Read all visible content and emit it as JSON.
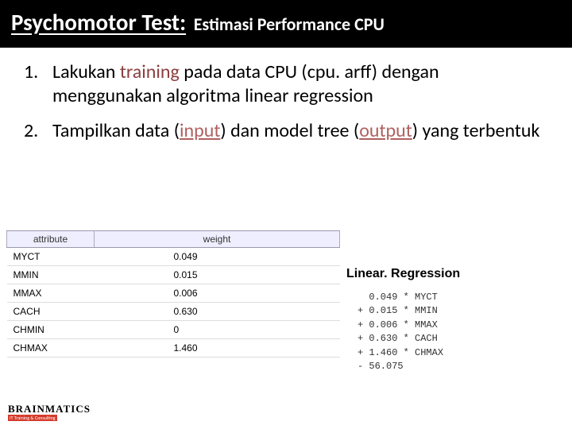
{
  "title": {
    "main": "Psychomotor Test:",
    "sub": "Estimasi Performance CPU"
  },
  "list": {
    "item1_pre": "Lakukan ",
    "item1_hl": "training",
    "item1_post": " pada data CPU (cpu. arff) dengan menggunakan algoritma linear regression",
    "item2_pre": "Tampilkan data (",
    "item2_in": "input",
    "item2_mid": ") dan model tree (",
    "item2_out": "output",
    "item2_post": ") yang terbentuk"
  },
  "table": {
    "headers": {
      "attr": "attribute",
      "weight": "weight"
    },
    "rows": [
      {
        "attr": "MYCT",
        "weight": "0.049"
      },
      {
        "attr": "MMIN",
        "weight": "0.015"
      },
      {
        "attr": "MMAX",
        "weight": "0.006"
      },
      {
        "attr": "CACH",
        "weight": "0.630"
      },
      {
        "attr": "CHMIN",
        "weight": "0"
      },
      {
        "attr": "CHMAX",
        "weight": "1.460"
      }
    ]
  },
  "regression": {
    "title": "Linear. Regression",
    "lines": [
      "  0.049 * MYCT",
      "+ 0.015 * MMIN",
      "+ 0.006 * MMAX",
      "+ 0.630 * CACH",
      "+ 1.460 * CHMAX",
      "- 56.075"
    ]
  },
  "footer": {
    "brand": "BRAINMATICS",
    "tag": "IT Training & Consulting"
  },
  "chart_data": {
    "type": "table",
    "title": "Linear Regression attribute weights",
    "columns": [
      "attribute",
      "weight"
    ],
    "rows": [
      [
        "MYCT",
        0.049
      ],
      [
        "MMIN",
        0.015
      ],
      [
        "MMAX",
        0.006
      ],
      [
        "CACH",
        0.63
      ],
      [
        "CHMIN",
        0
      ],
      [
        "CHMAX",
        1.46
      ]
    ],
    "equation_terms": [
      {
        "coef": 0.049,
        "var": "MYCT"
      },
      {
        "coef": 0.015,
        "var": "MMIN"
      },
      {
        "coef": 0.006,
        "var": "MMAX"
      },
      {
        "coef": 0.63,
        "var": "CACH"
      },
      {
        "coef": 1.46,
        "var": "CHMAX"
      }
    ],
    "intercept": -56.075
  }
}
